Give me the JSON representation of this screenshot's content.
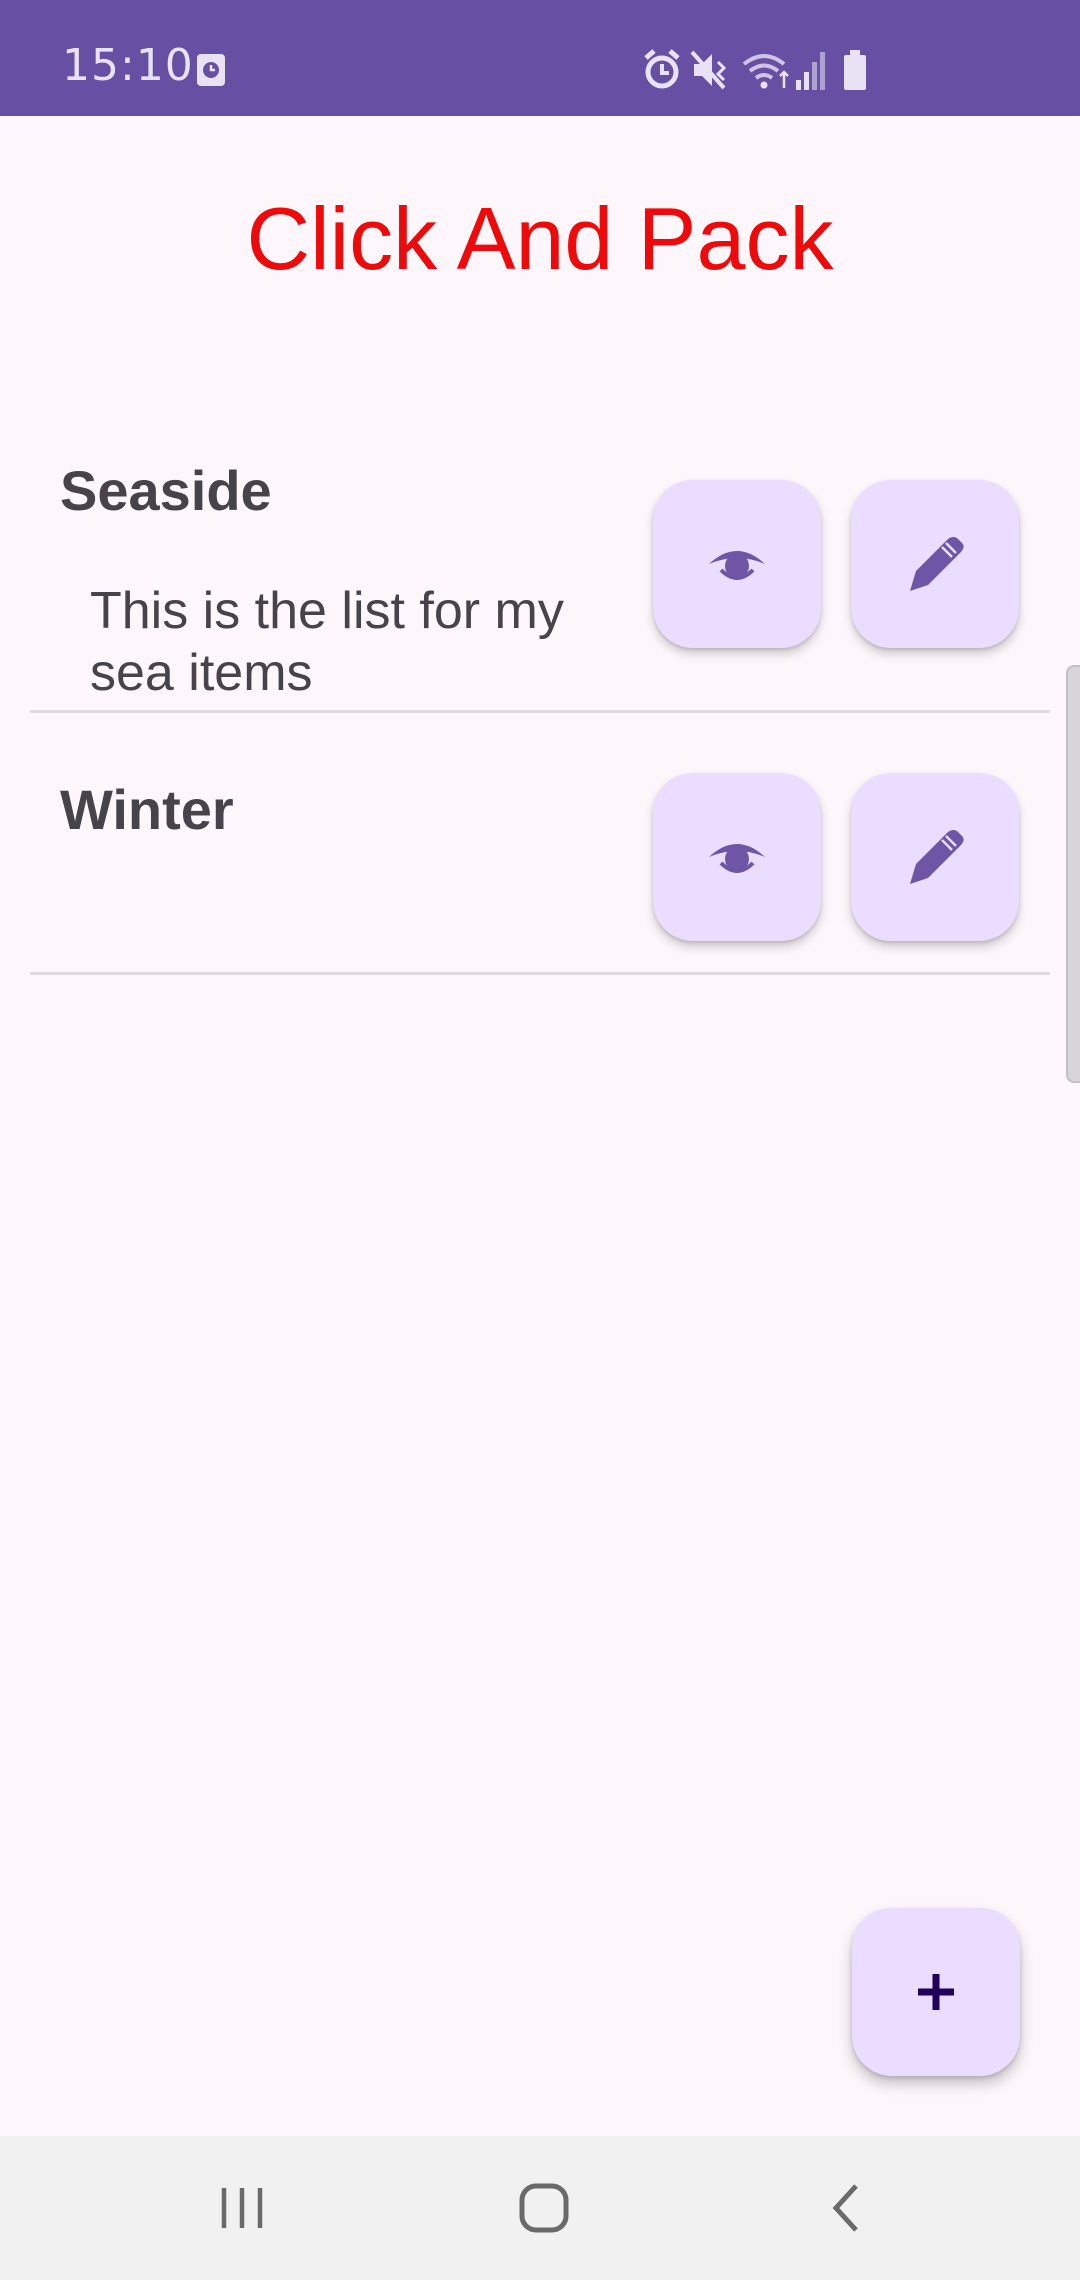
{
  "status_bar": {
    "time": "15:10",
    "icons": [
      "clock-badge-icon",
      "alarm-icon",
      "vibrate-mute-icon",
      "wifi-icon",
      "signal-icon",
      "battery-icon"
    ]
  },
  "app": {
    "title": "Click And Pack",
    "title_color": "#EE0A0A",
    "accent_color": "#6750A4",
    "button_bg_color": "#EADDFF"
  },
  "lists": [
    {
      "title": "Seaside",
      "description": "This is the list for my sea items"
    },
    {
      "title": "Winter",
      "description": ""
    }
  ],
  "actions": {
    "view_icon": "eye-icon",
    "edit_icon": "pencil-icon",
    "add_icon": "plus-icon"
  },
  "nav_bar": {
    "buttons": [
      "recent-apps-icon",
      "home-icon",
      "back-icon"
    ]
  }
}
